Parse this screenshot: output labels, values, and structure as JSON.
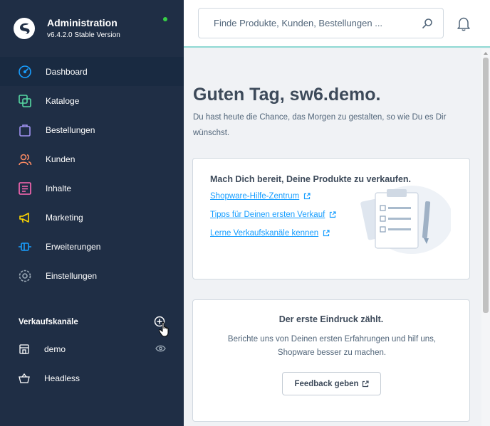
{
  "brand": {
    "title": "Administration",
    "version": "v6.4.2.0 Stable Version"
  },
  "nav": {
    "items": [
      {
        "label": "Dashboard"
      },
      {
        "label": "Kataloge"
      },
      {
        "label": "Bestellungen"
      },
      {
        "label": "Kunden"
      },
      {
        "label": "Inhalte"
      },
      {
        "label": "Marketing"
      },
      {
        "label": "Erweiterungen"
      },
      {
        "label": "Einstellungen"
      }
    ]
  },
  "sales_channels": {
    "title": "Verkaufskanäle",
    "items": [
      {
        "label": "demo"
      },
      {
        "label": "Headless"
      }
    ]
  },
  "header": {
    "search_placeholder": "Finde Produkte, Kunden, Bestellungen ..."
  },
  "main": {
    "greeting": "Guten Tag, sw6.demo.",
    "subline": "Du hast heute die Chance, das Morgen zu gestalten, so wie Du es Dir wünschst.",
    "card1": {
      "title": "Mach Dich bereit, Deine Produkte zu verkaufen.",
      "links": [
        "Shopware-Hilfe-Zentrum",
        "Tipps für Deinen ersten Verkauf",
        "Lerne Verkaufskanäle kennen"
      ]
    },
    "card2": {
      "title": "Der erste Eindruck zählt.",
      "text": "Berichte uns von Deinen ersten Erfahrungen und hilf uns, Shopware besser zu machen.",
      "button": "Feedback geben"
    }
  },
  "colors": {
    "sidebar": "#1f2e45",
    "sidebar_active": "#192a41",
    "link": "#189eff",
    "status_online": "#37d046",
    "header_border": "#8fd9d3"
  }
}
